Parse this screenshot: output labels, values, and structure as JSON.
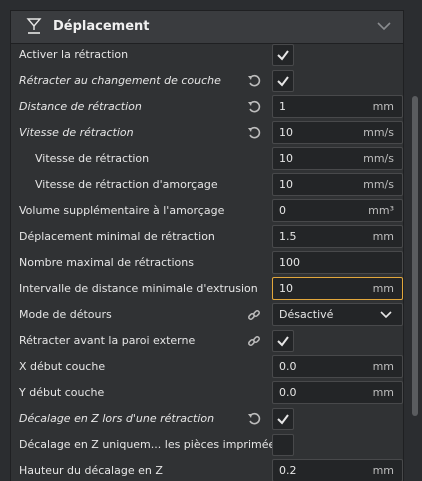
{
  "section": {
    "title": "Déplacement"
  },
  "rows": [
    {
      "label": "Activer la rétraction",
      "checked": true
    },
    {
      "label": "Rétracter au changement de couche",
      "checked": true
    },
    {
      "label": "Distance de rétraction",
      "value": "1",
      "unit": "mm"
    },
    {
      "label": "Vitesse de rétraction",
      "value": "10",
      "unit": "mm/s"
    },
    {
      "label": "Vitesse de rétraction",
      "value": "10",
      "unit": "mm/s"
    },
    {
      "label": "Vitesse de rétraction d'amorçage",
      "value": "10",
      "unit": "mm/s"
    },
    {
      "label": "Volume supplémentaire à l'amorçage",
      "value": "0",
      "unit": "mm³"
    },
    {
      "label": "Déplacement minimal de rétraction",
      "value": "1.5",
      "unit": "mm"
    },
    {
      "label": "Nombre maximal de rétractions",
      "value": "100",
      "unit": ""
    },
    {
      "label": "Intervalle de distance minimale d'extrusion",
      "value": "10",
      "unit": "mm"
    },
    {
      "label": "Mode de détours",
      "value": "Désactivé"
    },
    {
      "label": "Rétracter avant la paroi externe",
      "checked": true
    },
    {
      "label": "X début couche",
      "value": "0.0",
      "unit": "mm"
    },
    {
      "label": "Y début couche",
      "value": "0.0",
      "unit": "mm"
    },
    {
      "label": "Décalage en Z lors d'une rétraction",
      "checked": true
    },
    {
      "label": "Décalage en Z uniquem... les pièces imprimées",
      "checked": false
    },
    {
      "label": "Hauteur du décalage en Z",
      "value": "0.2",
      "unit": "mm"
    }
  ],
  "icons": {
    "header": "travel-nozzle-icon",
    "collapse": "chevron-down-icon",
    "reset": "reset-icon",
    "link": "link-icon",
    "check": "check-icon",
    "dropdown": "chevron-down-icon"
  },
  "colors": {
    "accent": "#e2a73c",
    "panel": "#303234",
    "field": "#232527"
  }
}
